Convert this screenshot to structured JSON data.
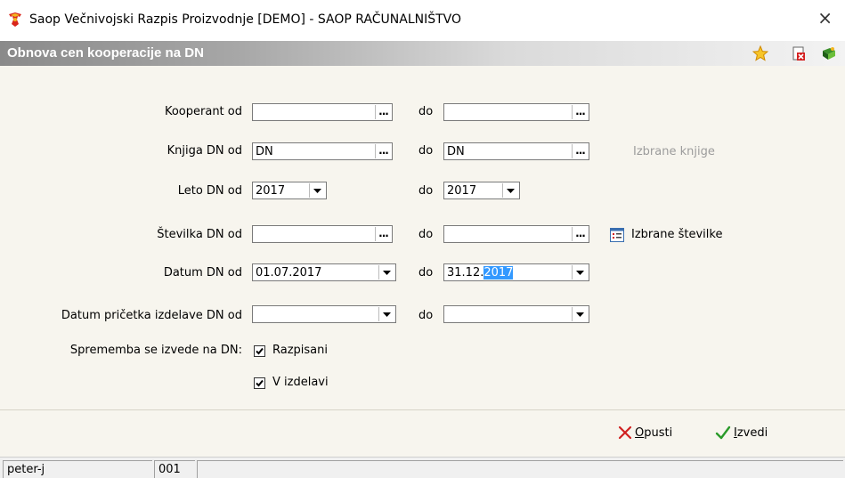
{
  "window": {
    "title": "Saop   Večnivojski Razpis Proizvodnje [DEMO] - SAOP RAČUNALNIŠTVO",
    "close_glyph": "×"
  },
  "header": {
    "title": "Obnova cen kooperacije na DN",
    "icons": [
      "star-icon",
      "document-delete-icon",
      "book-exit-icon"
    ]
  },
  "form": {
    "do_label": "do",
    "rows": [
      {
        "label": "Kooperant od",
        "from": "",
        "to": "",
        "kind": "lookup"
      },
      {
        "label": "Knjiga DN od",
        "from": "DN",
        "to": "DN",
        "kind": "lookup",
        "extra": "Izbrane knjige"
      },
      {
        "label": "Leto DN od",
        "from": "2017",
        "to": "2017",
        "kind": "combo-short"
      },
      {
        "label": "Številka DN od",
        "from": "",
        "to": "",
        "kind": "lookup",
        "extra": "Izbrane številke"
      },
      {
        "label": "Datum DN od",
        "from": "01.07.2017",
        "to_prefix": "31.12.",
        "to_selected": "2017",
        "kind": "date"
      },
      {
        "label": "Datum pričetka izdelave DN od",
        "from": "",
        "to": "",
        "kind": "date"
      }
    ],
    "change_label": "Sprememba se izvede na DN:",
    "checkboxes": [
      {
        "label": "Razpisani",
        "checked": true
      },
      {
        "label": "V izdelavi",
        "checked": true
      }
    ]
  },
  "footer": {
    "cancel": {
      "accel": "O",
      "rest": "pusti"
    },
    "run": {
      "accel": "I",
      "rest": "zvedi"
    }
  },
  "status": {
    "user": "peter-j",
    "code": "001",
    "message": ""
  },
  "colors": {
    "selection": "#3399ff",
    "cancel_icon": "#d02020",
    "run_icon": "#2a9a2a"
  }
}
